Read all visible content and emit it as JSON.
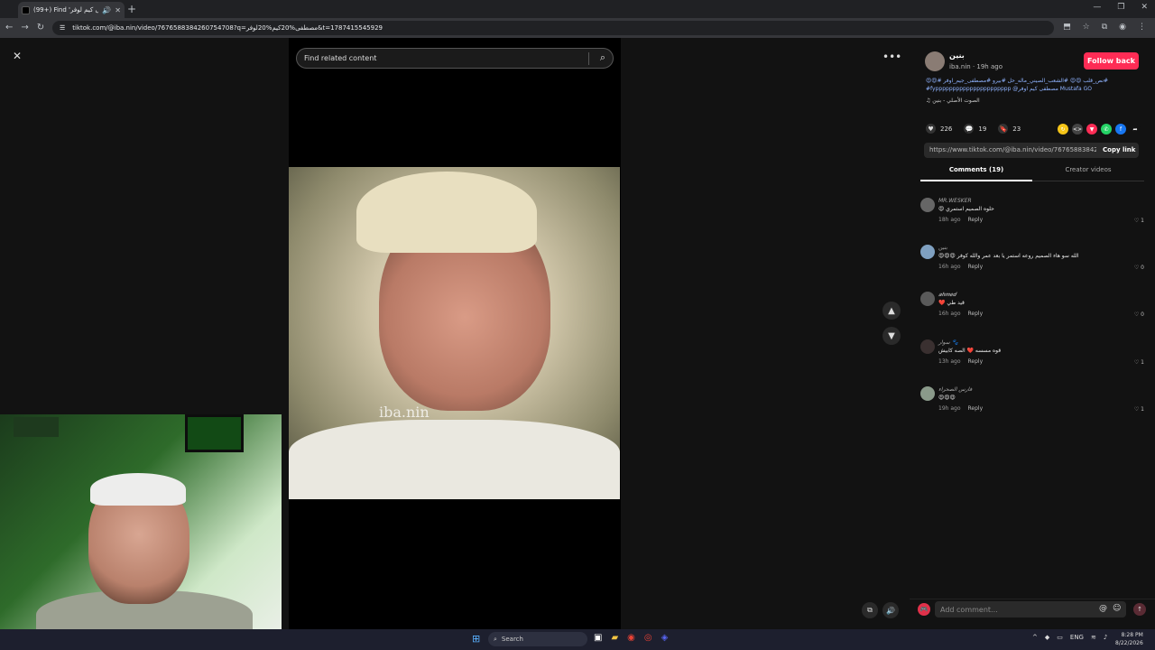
{
  "browser": {
    "tab_title": "(99+) Find 'مصطفى كيم لوفر'",
    "url": "tiktok.com/@iba.nin/video/7676588384260754708?q=مصطفى%20كيم%20لوفر&t=1787415545929"
  },
  "page": {
    "close_glyph": "✕",
    "search_placeholder": "Find related content",
    "watermark": "iba.nin"
  },
  "author": {
    "username": "بنين",
    "handle_time": "iba.nin · 19h ago",
    "follow_label": "Follow back",
    "desc_line1": "#نص_قلب 😍😍 #الشعب_الصيني_ماله_حل #بيرو #مصطفى_جيم_اوفر #😍😍",
    "desc_line2": "#fypppppppppppppppppppppp @مصطفى كيم اوفر Mustafa GO",
    "music": "الصوت الأصلي - بنين"
  },
  "stats": {
    "likes": "226",
    "comments": "19",
    "saves": "23"
  },
  "link": {
    "url": "https://www.tiktok.com/@iba.nin/video/767658838426...",
    "copy_label": "Copy link"
  },
  "tabs": {
    "comments": "Comments (19)",
    "creator": "Creator videos"
  },
  "comments": [
    {
      "name": "MR.WESKER",
      "text": "😍 حلوه الصميم استمري",
      "time": "18h ago",
      "reply": "Reply",
      "likes": "1"
    },
    {
      "name": "بنين",
      "text": "😍😍😍 الله سو هاء الصميم روعه استمر يا بعد عمر والله كوفر",
      "time": "16h ago",
      "reply": "Reply",
      "likes": "0"
    },
    {
      "name": "𝒂𝒉𝒎𝒆𝒅",
      "text": "❤️ قيد طي",
      "time": "16h ago",
      "reply": "Reply",
      "likes": "0"
    },
    {
      "name": "سوار 🐾",
      "text": "قوه مسسه ❤️ الصه كابيش",
      "time": "13h ago",
      "reply": "Reply",
      "likes": "1"
    },
    {
      "name": "فارس الصحراء",
      "text": "😍😍😍",
      "time": "19h ago",
      "reply": "Reply",
      "likes": "1"
    }
  ],
  "comment_bar": {
    "placeholder": "Add comment..."
  },
  "taskbar": {
    "search_label": "Search",
    "lang": "ENG",
    "time": "8:28 PM",
    "date": "8/22/2026"
  }
}
